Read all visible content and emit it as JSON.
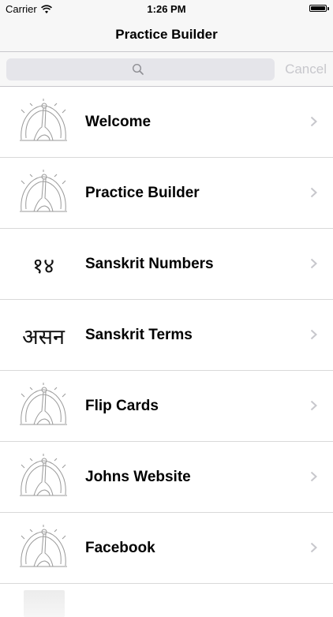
{
  "status_bar": {
    "carrier": "Carrier",
    "time": "1:26 PM",
    "battery_level": 1.0
  },
  "nav": {
    "title": "Practice Builder"
  },
  "search": {
    "placeholder": "",
    "value": "",
    "cancel_label": "Cancel",
    "icon": "search-icon"
  },
  "list": {
    "items": [
      {
        "label": "Welcome",
        "icon": "yoga-pose-icon"
      },
      {
        "label": "Practice Builder",
        "icon": "yoga-pose-icon"
      },
      {
        "label": "Sanskrit Numbers",
        "icon": "sanskrit-numbers-icon",
        "glyph": "१४"
      },
      {
        "label": "Sanskrit Terms",
        "icon": "sanskrit-terms-icon",
        "glyph": "असन"
      },
      {
        "label": "Flip Cards",
        "icon": "yoga-pose-icon"
      },
      {
        "label": "Johns Website",
        "icon": "yoga-pose-icon"
      },
      {
        "label": "Facebook",
        "icon": "yoga-pose-icon"
      }
    ]
  },
  "colors": {
    "bar_background": "#f7f7f7",
    "separator": "#d9d9d9",
    "search_field": "#e5e5ea",
    "cancel_disabled": "#c7c7cc",
    "chevron": "#c7c7cc"
  }
}
